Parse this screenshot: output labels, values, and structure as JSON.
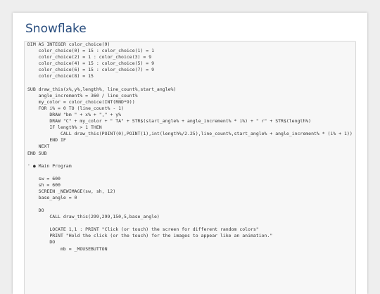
{
  "page": {
    "title": "Snowflake"
  },
  "code": {
    "lines": [
      "DIM AS INTEGER color_choice(9)",
      "    color_choice(0) = 15 : color_choice(1) = 1",
      "    color_choice(2) = 1 : color_choice(3) = 9",
      "    color_choice(4) = 15 : color_choice(5) = 9",
      "    color_choice(6) = 15 : color_choice(7) = 9",
      "    color_choice(8) = 15",
      "",
      "SUB draw_this(x%,y%,length%, line_count%,start_angle%)",
      "    angle_increment% = 360 / line_count%",
      "    my_color = color_choice(INT(RND*9))",
      "    FOR i% = 0 TO (line_count% - 1)",
      "        DRAW \"bm \" + x% + \",\" + y%",
      "        DRAW \"C\" + my_color + \" TA\" + STR$(start_angle% + angle_increment% * i%) + \" r\" + STR$(length%)",
      "        IF length% > 1 THEN",
      "            CALL draw_this(POINT(0),POINT(1),int(length%/2.25),line_count%,start_angle% + angle_increment% * (i% + 1))",
      "        END IF",
      "    NEXT",
      "END SUB",
      "",
      "' ● Main Program",
      "",
      "    sw = 600",
      "    sh = 600",
      "    SCREEN _NEWIMAGE(sw, sh, 12)",
      "    base_angle = 0",
      "",
      "    DO",
      "        CALL draw_this(299,299,150,5,base_angle)",
      "",
      "        LOCATE 1,1 : PRINT \"Click (or touch) the screen for different random colors\"",
      "        PRINT \"Hold the click (or the touch) for the images to appear like an animation.\"",
      "        DO",
      "            mb = _MOUSEBUTTON"
    ]
  }
}
